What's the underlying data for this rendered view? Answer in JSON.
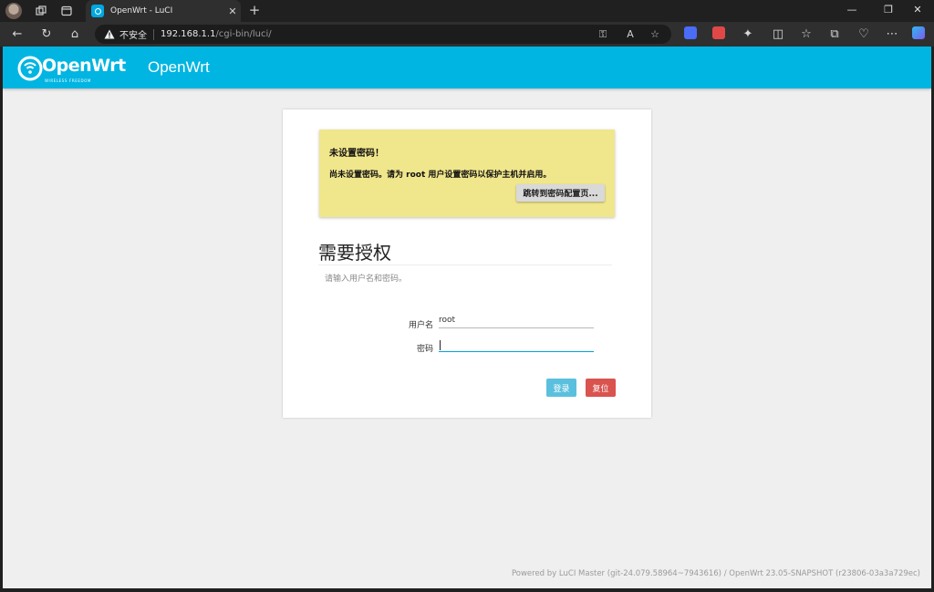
{
  "browser": {
    "tab_title": "OpenWrt - LuCI",
    "address_insecure": "不安全",
    "address_host": "192.168.1.1",
    "address_path": "/cgi-bin/luci/"
  },
  "header": {
    "logo_text": "OpenWrt",
    "logo_tagline": "WIRELESS FREEDOM",
    "brand": "OpenWrt"
  },
  "alert": {
    "title": "未设置密码！",
    "text": "尚未设置密码。请为 root 用户设置密码以保护主机并启用。",
    "button_label": "跳转到密码配置页..."
  },
  "login": {
    "title": "需要授权",
    "description": "请输入用户名和密码。",
    "username_label": "用户名",
    "username_value": "root",
    "password_label": "密码",
    "password_value": "",
    "login_button": "登录",
    "reset_button": "复位"
  },
  "footer": {
    "text": "Powered by LuCI Master (git-24.079.58964~7943616) / OpenWrt 23.05-SNAPSHOT (r23806-03a3a729ec)"
  },
  "colors": {
    "header_bg": "#00b5e2",
    "alert_bg": "#f0e68c",
    "login_button": "#5bc0de",
    "reset_button": "#d9534f",
    "focus_underline": "#00a3d9"
  }
}
